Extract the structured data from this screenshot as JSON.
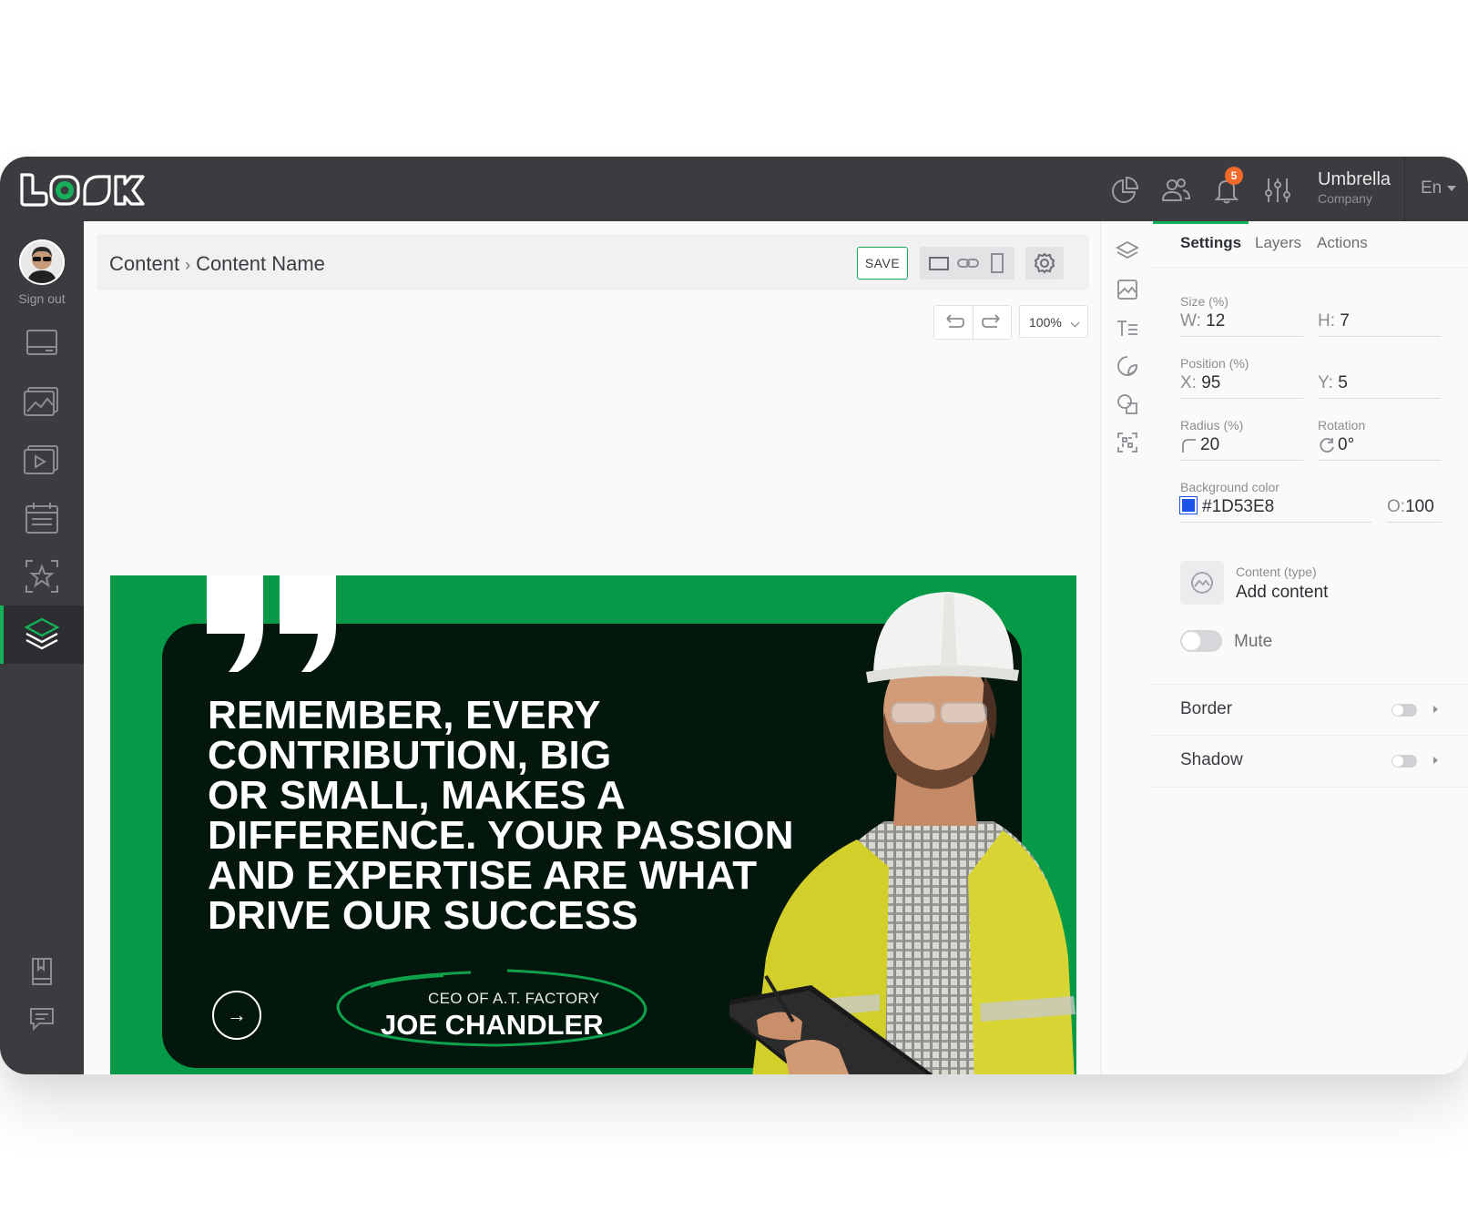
{
  "brand": {
    "accent": "#14b05a",
    "logo_text": "LOOK"
  },
  "topbar": {
    "notification_count": "5",
    "company_name": "Umbrella",
    "company_sub": "Company",
    "language": "En"
  },
  "sidebar": {
    "signout_label": "Sign out",
    "items": [
      {
        "icon": "display-icon"
      },
      {
        "icon": "image-icon"
      },
      {
        "icon": "video-icon"
      },
      {
        "icon": "calendar-icon"
      },
      {
        "icon": "star-frame-icon"
      },
      {
        "icon": "layers-icon",
        "active": true
      },
      {
        "icon": "book-icon"
      },
      {
        "icon": "chat-icon"
      }
    ]
  },
  "breadcrumb": {
    "root": "Content",
    "separator": "›",
    "current": "Content Name"
  },
  "toolbar": {
    "save_label": "SAVE",
    "zoom": "100%"
  },
  "canvas": {
    "headline": [
      "REMEMBER, EVERY",
      "CONTRIBUTION, BIG",
      "OR SMALL, MAKES A",
      "DIFFERENCE. YOUR PASSION",
      "AND EXPERTISE ARE WHAT",
      "DRIVE OUR SUCCESS"
    ],
    "arrow": "→",
    "person_title": "CEO OF A.T. FACTORY",
    "person_name": "JOE CHANDLER",
    "bg_color": "#069a48"
  },
  "panel": {
    "tabs": [
      "Settings",
      "Layers",
      "Actions"
    ],
    "size_label": "Size (%)",
    "w_prefix": "W:",
    "w_value": "12",
    "h_prefix": "H:",
    "h_value": "7",
    "position_label": "Position (%)",
    "x_prefix": "X:",
    "x_value": "95",
    "y_prefix": "Y:",
    "y_value": "5",
    "radius_label": "Radius (%)",
    "radius_value": "20",
    "rotation_label": "Rotation",
    "rotation_value": "0°",
    "bgcolor_label": "Background color",
    "bgcolor_value": "#1D53E8",
    "opacity_prefix": "O:",
    "opacity_value": "100",
    "content_type_label": "Content (type)",
    "content_type_value": "Add content",
    "mute_label": "Mute",
    "border_label": "Border",
    "shadow_label": "Shadow"
  }
}
